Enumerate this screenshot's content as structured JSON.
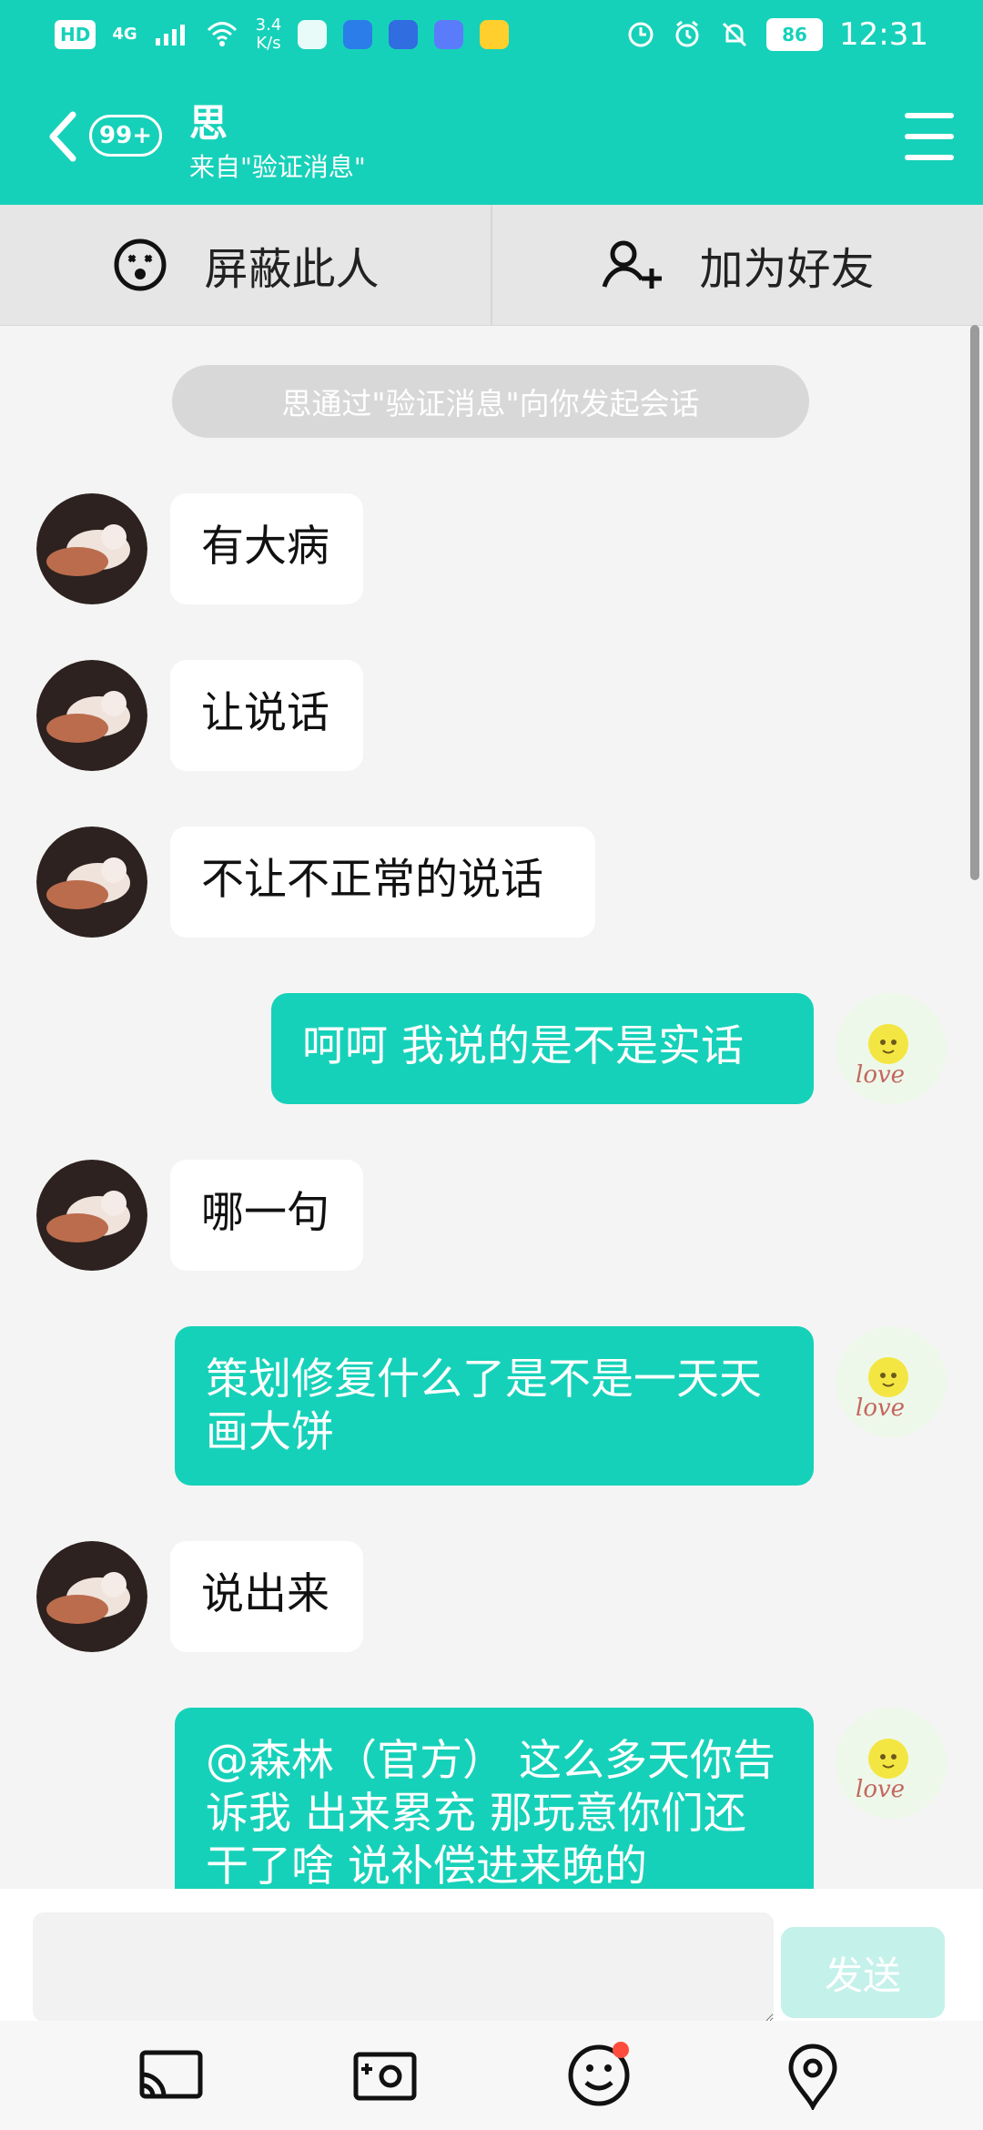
{
  "status": {
    "left_tag": "HD",
    "network": "4G",
    "speed_value": "3.4",
    "speed_unit": "K/s",
    "battery": "86",
    "time": "12:31"
  },
  "header": {
    "unread_badge": "99+",
    "contact_name": "思",
    "contact_subtitle": "来自\"验证消息\""
  },
  "actions": {
    "block_label": "屏蔽此人",
    "add_friend_label": "加为好友"
  },
  "chat": {
    "notice": "思通过\"验证消息\"向你发起会话",
    "messages": [
      {
        "side": "left",
        "text": "有大病"
      },
      {
        "side": "left",
        "text": "让说话"
      },
      {
        "side": "left",
        "text": "不让不正常的说话"
      },
      {
        "side": "right",
        "text": "呵呵  我说的是不是实话"
      },
      {
        "side": "left",
        "text": "哪一句"
      },
      {
        "side": "right",
        "text": "策划修复什么了是不是一天天画大饼"
      },
      {
        "side": "left",
        "text": "说出来"
      },
      {
        "side": "right",
        "text": "@森林（官方） 这么多天你告诉我  出来累充  那玩意你们还干了啥  说补偿进来晚的"
      }
    ]
  },
  "composer": {
    "send_label": "发送",
    "input_value": ""
  },
  "colors": {
    "accent": "#16d1b9",
    "bubble_in": "#ffffff",
    "background": "#f4f4f4"
  },
  "icons": {
    "back": "chevron-left-icon",
    "menu": "menu-icon",
    "block": "blocked-face-icon",
    "add_friend": "add-user-icon",
    "cast": "cast-icon",
    "camera": "camera-icon",
    "emoji": "emoji-icon",
    "location": "location-icon"
  }
}
